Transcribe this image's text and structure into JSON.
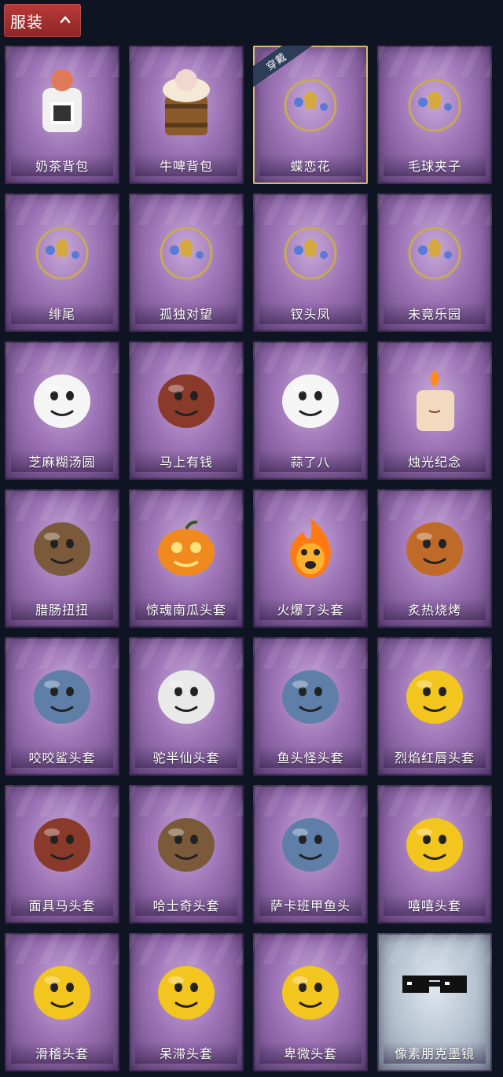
{
  "header": {
    "tab_label": "服装"
  },
  "items": [
    {
      "name": "奶茶背包",
      "icon": "milk-tea-backpack-icon"
    },
    {
      "name": "牛啤背包",
      "icon": "cow-beer-backpack-icon"
    },
    {
      "name": "蝶恋花",
      "icon": "butterfly-bell-icon",
      "badge": "穿戴",
      "selected": true
    },
    {
      "name": "毛球夹子",
      "icon": "raccoon-clip-icon"
    },
    {
      "name": "绯尾",
      "icon": "fox-charm-icon"
    },
    {
      "name": "孤独对望",
      "icon": "doll-charm-icon"
    },
    {
      "name": "钗头凤",
      "icon": "phoenix-crown-icon"
    },
    {
      "name": "未竟乐园",
      "icon": "star-doll-icon"
    },
    {
      "name": "芝麻糊汤圆",
      "icon": "rice-ball-icon"
    },
    {
      "name": "马上有钱",
      "icon": "horse-head-icon"
    },
    {
      "name": "蒜了八",
      "icon": "garlic-icon"
    },
    {
      "name": "烛光纪念",
      "icon": "candle-icon"
    },
    {
      "name": "腊肠扭扭",
      "icon": "dog-head-icon"
    },
    {
      "name": "惊魂南瓜头套",
      "icon": "pumpkin-mask-icon"
    },
    {
      "name": "火爆了头套",
      "icon": "fire-mask-icon"
    },
    {
      "name": "炙热烧烤",
      "icon": "bbq-mask-icon"
    },
    {
      "name": "咬咬鲨头套",
      "icon": "shark-mask-icon"
    },
    {
      "name": "驼半仙头套",
      "icon": "panda-sunglasses-mask-icon"
    },
    {
      "name": "鱼头怪头套",
      "icon": "fish-head-mask-icon"
    },
    {
      "name": "烈焰红唇头套",
      "icon": "yellow-lips-mask-icon"
    },
    {
      "name": "面具马头套",
      "icon": "horse-mask-icon"
    },
    {
      "name": "哈士奇头套",
      "icon": "husky-mask-icon"
    },
    {
      "name": "萨卡班甲鱼头",
      "icon": "armored-fish-mask-icon"
    },
    {
      "name": "嘻嘻头套",
      "icon": "grin-emoji-mask-icon"
    },
    {
      "name": "滑稽头套",
      "icon": "funny-emoji-mask-icon"
    },
    {
      "name": "呆滞头套",
      "icon": "dazed-emoji-mask-icon"
    },
    {
      "name": "卑微头套",
      "icon": "humble-emoji-mask-icon"
    },
    {
      "name": "像素朋克墨镜",
      "icon": "pixel-sunglasses-icon",
      "style": "gray"
    }
  ],
  "colors": {
    "background": "#0f1422",
    "header_tab": "#a83232",
    "card_purple": "#9c72b5",
    "card_gray": "#b7c3d1",
    "selected_border": "#d8b86a"
  }
}
